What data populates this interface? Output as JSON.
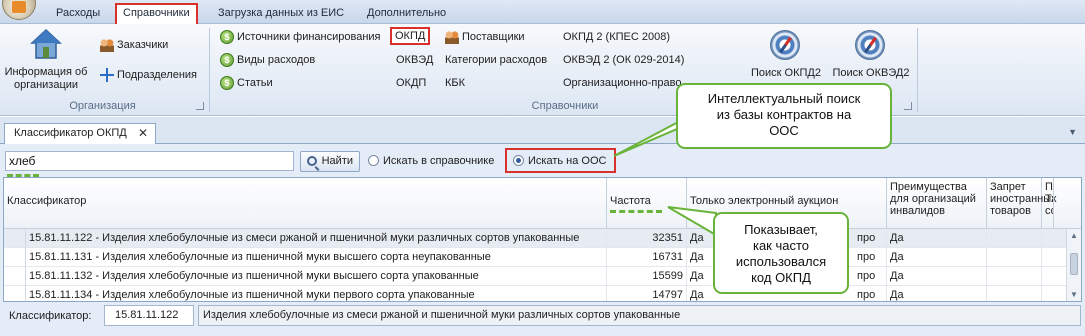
{
  "menu": {
    "tabs": [
      "Расходы",
      "Справочники",
      "Загрузка данных из ЕИС",
      "Дополнительно"
    ],
    "active_tab": "Справочники"
  },
  "ribbon": {
    "org_group": {
      "label": "Организация",
      "org_info_line1": "Информация об",
      "org_info_line2": "организации",
      "customers": "Заказчики",
      "departments": "Подразделения"
    },
    "ref_group": {
      "label": "Справочники",
      "col1": [
        "Источники финансирования",
        "Виды расходов",
        "Статьи"
      ],
      "col2": [
        "ОКПД",
        "ОКВЭД",
        "ОКДП"
      ],
      "col3": [
        "Поставщики",
        "Категории расходов",
        "КБК"
      ],
      "col4": [
        "ОКПД 2 (КПЕС 2008)",
        "ОКВЭД 2 (ОК 029-2014)",
        "Организационно-правов"
      ],
      "search_okpd2": "Поиск ОКПД2",
      "search_okved2": "Поиск ОКВЭД2"
    }
  },
  "doc_tab": {
    "title": "Классификатор ОКПД",
    "close": "✕"
  },
  "search": {
    "query": "хлеб",
    "find_label": "Найти",
    "opt_reference": "Искать в справочнике",
    "opt_oos": "Искать на ООС",
    "selected": "oos"
  },
  "grid": {
    "columns": [
      "Классификатор",
      "Частота",
      "Только электронный аукцион",
      "Преимущества для организаций инвалидов",
      "Запрет иностранных товаров",
      "Пр Та со"
    ],
    "rows": [
      {
        "code": "15.81.11.122 - Изделия хлебобулочные из смеси ржаной и пшеничной муки различных сортов упакованные",
        "freq": "32351",
        "auction": "Да",
        "disabled": "Да"
      },
      {
        "code": "15.81.11.131 - Изделия хлебобулочные из пшеничной муки высшего сорта неупакованные",
        "freq": "16731",
        "auction": "Да",
        "disabled": "Да"
      },
      {
        "code": "15.81.11.132 - Изделия хлебобулочные из пшеничной муки высшего сорта упакованные",
        "freq": "15599",
        "auction": "Да",
        "disabled": "Да"
      },
      {
        "code": "15.81.11.134 - Изделия хлебобулочные из пшеничной муки первого сорта упакованные",
        "freq": "14797",
        "auction": "Да",
        "disabled": "Да"
      }
    ],
    "partial_cell_text": "про"
  },
  "footer": {
    "label": "Классификатор:",
    "code": "15.81.11.122",
    "description": "Изделия хлебобулочные из смеси ржаной и пшеничной муки различных сортов упакованные"
  },
  "callouts": {
    "search_line1": "Интеллектуальный поиск",
    "search_line2": "из базы контрактов на",
    "search_line3": "ООС",
    "freq_line1": "Показывает,",
    "freq_line2": "как часто",
    "freq_line3": "использовался",
    "freq_line4": "код ОКПД"
  },
  "colors": {
    "highlight_red": "#d8302b",
    "callout_green": "#6ab33a",
    "ribbon_blue": "#dce6f3"
  }
}
